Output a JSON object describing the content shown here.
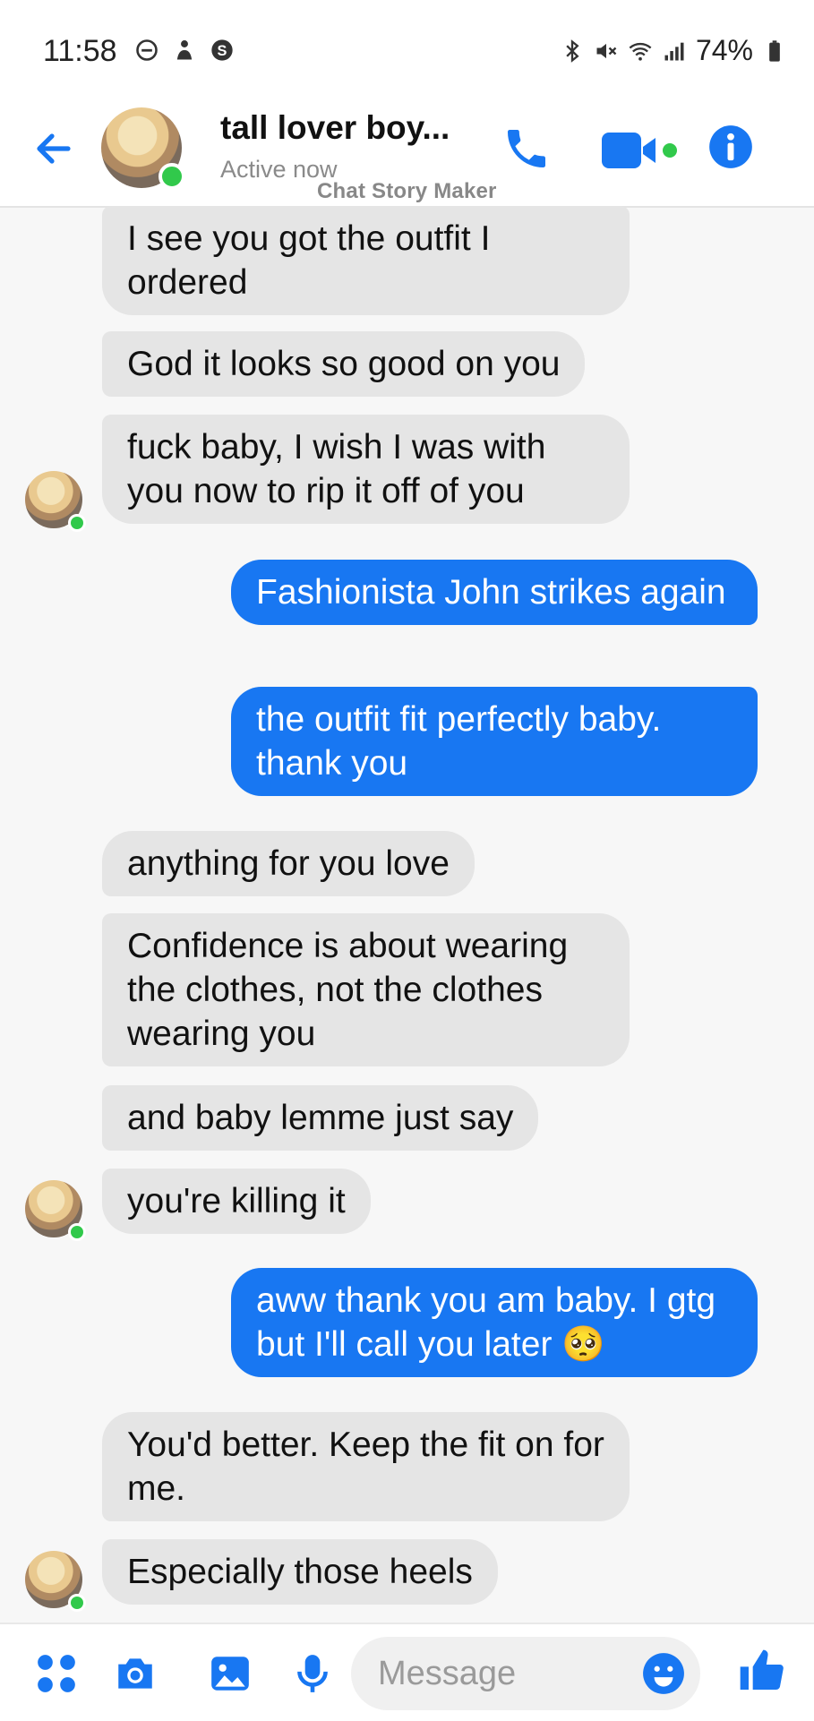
{
  "status_bar": {
    "time": "11:58",
    "battery": "74%",
    "left_icons": [
      "do-not-disturb-icon",
      "profile-icon",
      "skype-icon"
    ],
    "right_icons": [
      "bluetooth-icon",
      "mute-icon",
      "wifi-icon",
      "signal-icon",
      "battery-icon"
    ]
  },
  "header": {
    "name": "tall lover boy...",
    "status": "Active now",
    "watermark": "Chat Story Maker",
    "icons": [
      "back-arrow-icon",
      "phone-icon",
      "video-call-icon",
      "info-icon"
    ]
  },
  "colors": {
    "accent": "#1877f2",
    "incoming_bubble": "#e5e5e5",
    "online": "#31c94b"
  },
  "messages": [
    {
      "dir": "in",
      "text": "I see you got the outfit I ordered"
    },
    {
      "dir": "in",
      "text": "God it looks so good on you"
    },
    {
      "dir": "in",
      "text": "fuck baby, I wish I was with you now to rip it off of you"
    },
    {
      "dir": "out",
      "text": "Fashionista John strikes again"
    },
    {
      "dir": "out",
      "text": "the outfit fit perfectly baby. thank you"
    },
    {
      "dir": "in",
      "text": "anything for you love"
    },
    {
      "dir": "in",
      "text": "Confidence is about wearing the clothes, not the clothes wearing you"
    },
    {
      "dir": "in",
      "text": "and baby lemme just say"
    },
    {
      "dir": "in",
      "text": "you're killing it"
    },
    {
      "dir": "out",
      "text": "aww thank you am baby. I gtg but I'll call you later 🥺"
    },
    {
      "dir": "in",
      "text": "You'd better. Keep the fit on for me."
    },
    {
      "dir": "in",
      "text": "Especially those heels"
    }
  ],
  "composer": {
    "placeholder": "Message",
    "icons": [
      "apps-icon",
      "camera-icon",
      "gallery-icon",
      "microphone-icon",
      "emoji-icon",
      "thumbs-up-icon"
    ]
  }
}
